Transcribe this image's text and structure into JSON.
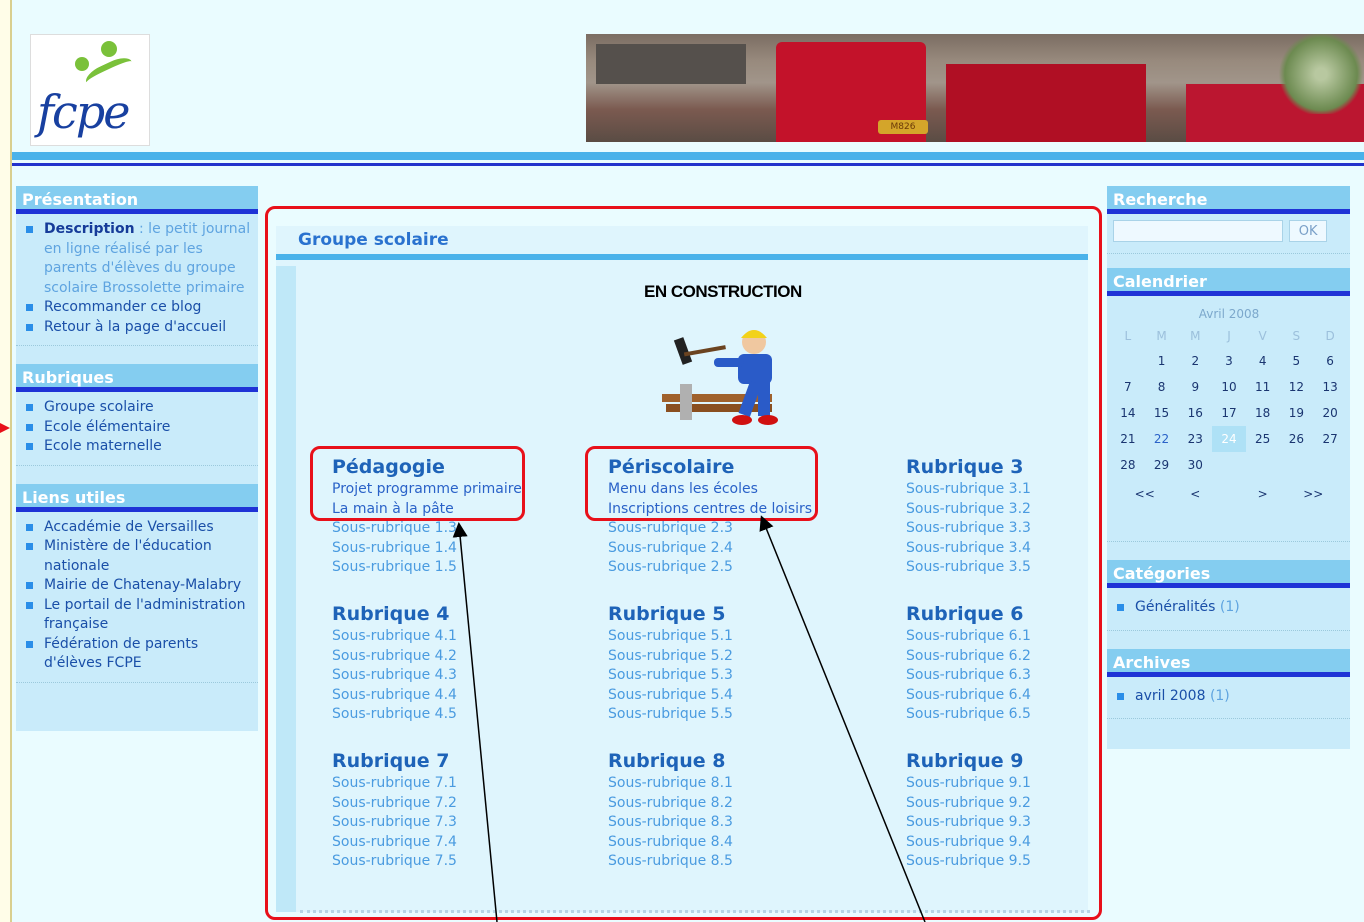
{
  "header": {
    "logo_text": "fcpe",
    "banner_plate": "M826"
  },
  "left_sidebar": {
    "presentation": {
      "title": "Présentation",
      "description_label": "Description",
      "description_text": " : le petit journal en ligne réalisé par les parents d'élèves du groupe scolaire Brossolette primaire",
      "items": [
        "Recommander ce blog",
        "Retour à la page d'accueil"
      ]
    },
    "rubriques": {
      "title": "Rubriques",
      "items": [
        "Groupe scolaire",
        "Ecole élémentaire",
        "Ecole maternelle"
      ]
    },
    "liens": {
      "title": "Liens utiles",
      "items": [
        "Accadémie de Versailles",
        "Ministère de l'éducation nationale",
        "Mairie de Chatenay-Malabry",
        "Le portail de l'administration française",
        "Fédération de parents d'élèves FCPE"
      ]
    }
  },
  "main": {
    "title": "Groupe scolaire",
    "construction": "EN CONSTRUCTION",
    "sections": [
      {
        "title": "Pédagogie",
        "items": [
          "Projet programme primaire",
          "La main à la pâte",
          "Sous-rubrique 1.3",
          "Sous-rubrique 1.4",
          "Sous-rubrique 1.5"
        ]
      },
      {
        "title": "Périscolaire",
        "items": [
          "Menu dans les écoles",
          "Inscriptions centres de loisirs",
          "Sous-rubrique 2.3",
          "Sous-rubrique 2.4",
          "Sous-rubrique 2.5"
        ]
      },
      {
        "title": "Rubrique 3",
        "items": [
          "Sous-rubrique 3.1",
          "Sous-rubrique 3.2",
          "Sous-rubrique 3.3",
          "Sous-rubrique 3.4",
          "Sous-rubrique 3.5"
        ]
      },
      {
        "title": "Rubrique 4",
        "items": [
          "Sous-rubrique 4.1",
          "Sous-rubrique 4.2",
          "Sous-rubrique 4.3",
          "Sous-rubrique 4.4",
          "Sous-rubrique 4.5"
        ]
      },
      {
        "title": "Rubrique 5",
        "items": [
          "Sous-rubrique 5.1",
          "Sous-rubrique 5.2",
          "Sous-rubrique 5.3",
          "Sous-rubrique 5.4",
          "Sous-rubrique 5.5"
        ]
      },
      {
        "title": "Rubrique 6",
        "items": [
          "Sous-rubrique 6.1",
          "Sous-rubrique 6.2",
          "Sous-rubrique 6.3",
          "Sous-rubrique 6.4",
          "Sous-rubrique 6.5"
        ]
      },
      {
        "title": "Rubrique 7",
        "items": [
          "Sous-rubrique 7.1",
          "Sous-rubrique 7.2",
          "Sous-rubrique 7.3",
          "Sous-rubrique 7.4",
          "Sous-rubrique 7.5"
        ]
      },
      {
        "title": "Rubrique 8",
        "items": [
          "Sous-rubrique 8.1",
          "Sous-rubrique 8.2",
          "Sous-rubrique 8.3",
          "Sous-rubrique 8.4",
          "Sous-rubrique 8.5"
        ]
      },
      {
        "title": "Rubrique 9",
        "items": [
          "Sous-rubrique 9.1",
          "Sous-rubrique 9.2",
          "Sous-rubrique 9.3",
          "Sous-rubrique 9.4",
          "Sous-rubrique 9.5"
        ]
      }
    ]
  },
  "right_sidebar": {
    "search": {
      "title": "Recherche",
      "button": "OK",
      "value": ""
    },
    "calendar": {
      "title": "Calendrier",
      "month": "Avril 2008",
      "day_headers": [
        "L",
        "M",
        "M",
        "J",
        "V",
        "S",
        "D"
      ],
      "weeks": [
        [
          "",
          "1",
          "2",
          "3",
          "4",
          "5",
          "6"
        ],
        [
          "7",
          "8",
          "9",
          "10",
          "11",
          "12",
          "13"
        ],
        [
          "14",
          "15",
          "16",
          "17",
          "18",
          "19",
          "20"
        ],
        [
          "21",
          "22",
          "23",
          "24",
          "25",
          "26",
          "27"
        ],
        [
          "28",
          "29",
          "30",
          "",
          "",
          "",
          ""
        ]
      ],
      "highlight_day": "22",
      "today": "24",
      "nav": [
        "<<",
        "<",
        ">",
        ">>"
      ]
    },
    "categories": {
      "title": "Catégories",
      "items": [
        {
          "label": "Généralités",
          "count": "(1)"
        }
      ]
    },
    "archives": {
      "title": "Archives",
      "items": [
        {
          "label": "avril 2008",
          "count": "(1)"
        }
      ]
    }
  },
  "colors": {
    "page_bg": "#eafcff",
    "header_band": "#4ab2ea",
    "accent_dark_blue": "#1f33d6",
    "sidebar_head": "#84cdf0",
    "annotation_red": "#e8101a"
  }
}
